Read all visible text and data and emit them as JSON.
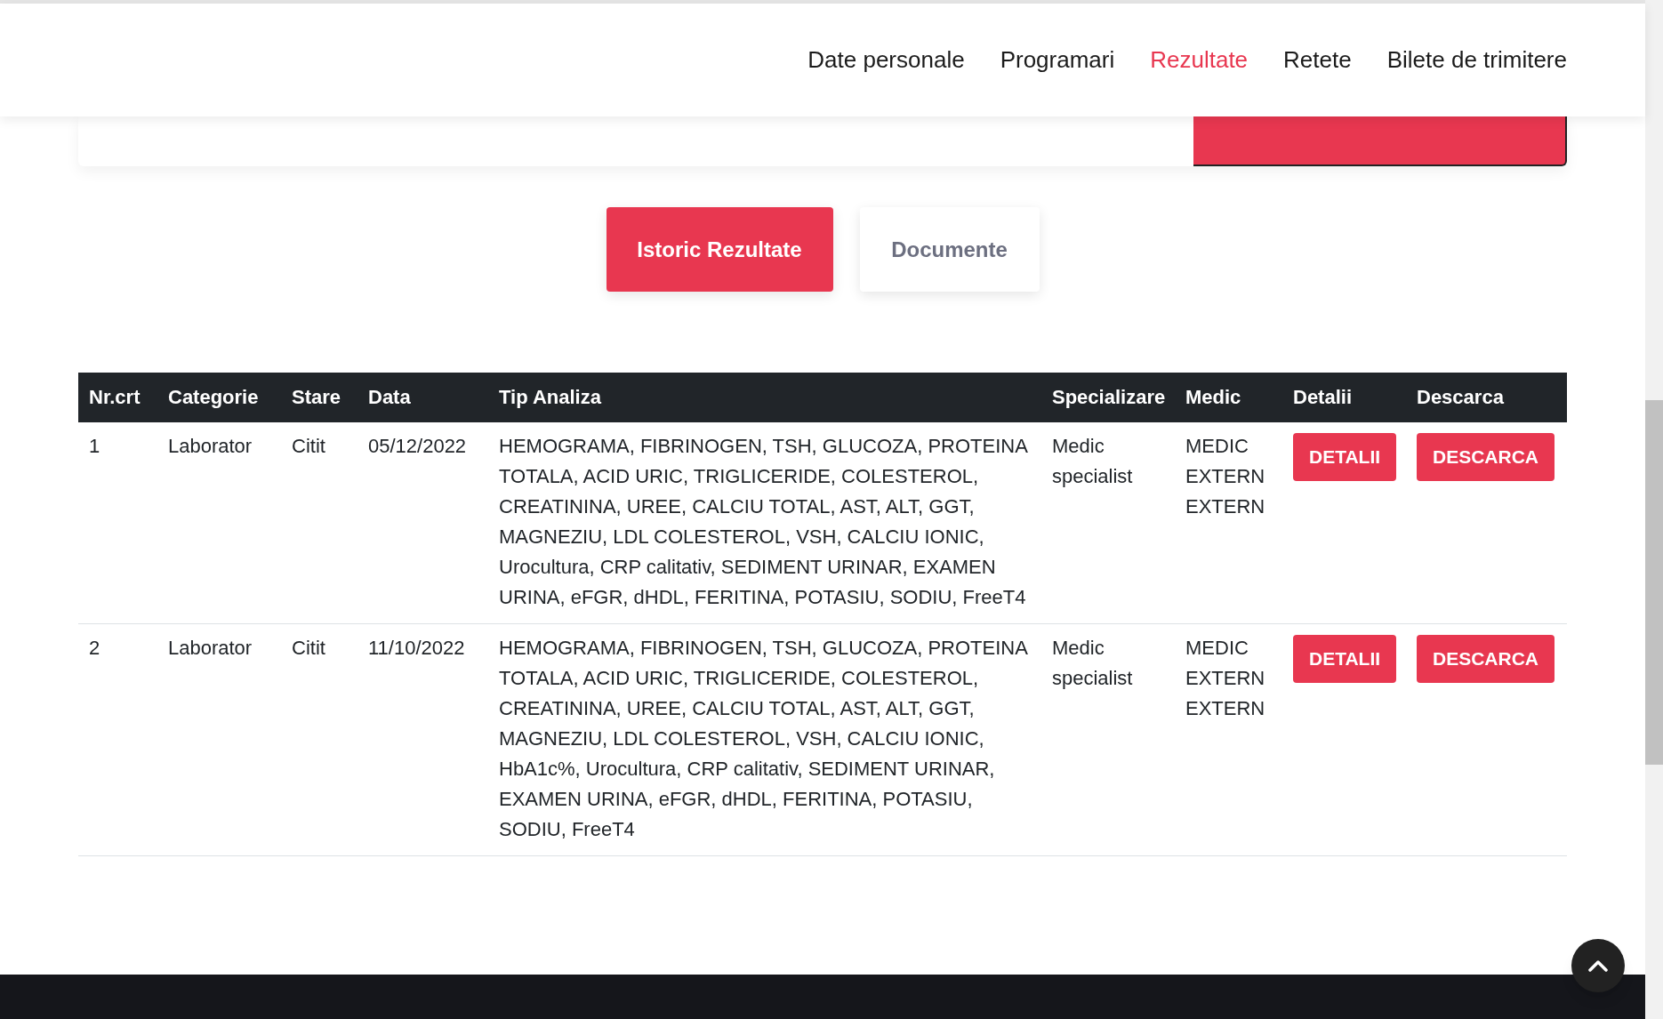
{
  "nav": [
    {
      "label": "Date personale",
      "selected": false
    },
    {
      "label": "Programari",
      "selected": false
    },
    {
      "label": "Rezultate",
      "selected": true
    },
    {
      "label": "Retete",
      "selected": false
    },
    {
      "label": "Bilete de trimitere",
      "selected": false
    }
  ],
  "tabs": [
    {
      "label": "Istoric Rezultate",
      "selected": true
    },
    {
      "label": "Documente",
      "selected": false
    }
  ],
  "table": {
    "columns": [
      "Nr.crt",
      "Categorie",
      "Stare",
      "Data",
      "Tip Analiza",
      "Specializare",
      "Medic",
      "Detalii",
      "Descarca"
    ],
    "rows": [
      {
        "nr": "1",
        "categorie": "Laborator",
        "stare": "Citit",
        "data": "05/12/2022",
        "tip": "HEMOGRAMA, FIBRINOGEN, TSH, GLUCOZA, PROTEINA TOTALA, ACID URIC, TRIGLICERIDE, COLESTEROL, CREATININA, UREE, CALCIU TOTAL, AST, ALT, GGT, MAGNEZIU, LDL COLESTEROL, VSH, CALCIU IONIC, Urocultura, CRP calitativ, SEDIMENT URINAR, EXAMEN URINA, eFGR, dHDL, FERITINA, POTASIU, SODIU, FreeT4",
        "specializare": "Medic specialist",
        "medic": "MEDIC EXTERN EXTERN",
        "detalii": "DETALII",
        "descarca": "DESCARCA"
      },
      {
        "nr": "2",
        "categorie": "Laborator",
        "stare": "Citit",
        "data": "11/10/2022",
        "tip": "HEMOGRAMA, FIBRINOGEN, TSH, GLUCOZA, PROTEINA TOTALA, ACID URIC, TRIGLICERIDE, COLESTEROL, CREATININA, UREE, CALCIU TOTAL, AST, ALT, GGT, MAGNEZIU, LDL COLESTEROL, VSH, CALCIU IONIC, HbA1c%, Urocultura, CRP calitativ, SEDIMENT URINAR, EXAMEN URINA, eFGR, dHDL, FERITINA, POTASIU, SODIU, FreeT4",
        "specializare": "Medic specialist",
        "medic": "MEDIC EXTERN EXTERN",
        "detalii": "DETALII",
        "descarca": "DESCARCA"
      }
    ]
  }
}
